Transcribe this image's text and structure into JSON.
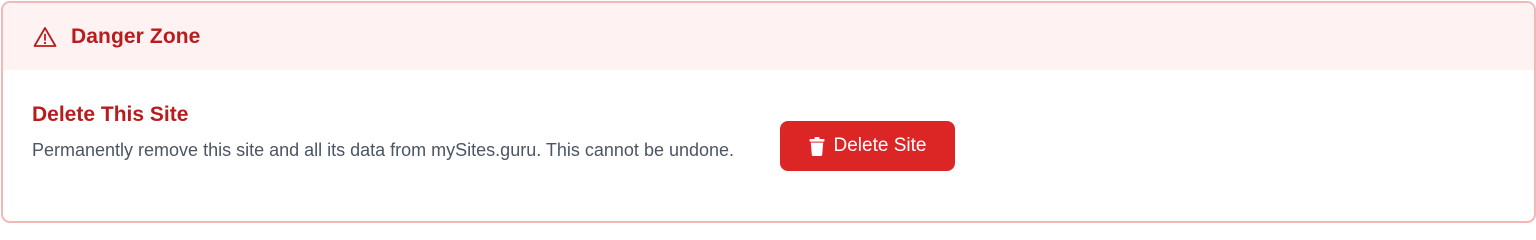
{
  "danger_zone": {
    "header_title": "Danger Zone",
    "header_icon": "warning-triangle-icon",
    "accent_color": "#b91c1c",
    "border_color": "#f2b8b8",
    "header_bg": "#fef2f2"
  },
  "delete_site": {
    "title": "Delete This Site",
    "description": "Permanently remove this site and all its data from mySites.guru. This cannot be undone.",
    "button_label": "Delete Site",
    "button_icon": "trash-icon",
    "button_color": "#dc2626"
  }
}
